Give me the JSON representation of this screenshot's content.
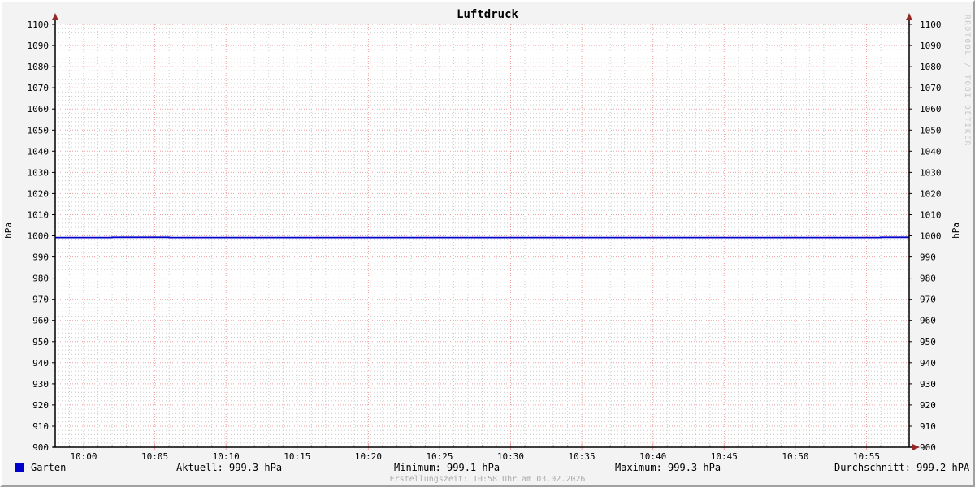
{
  "watermark": "RRDTOOL / TOBI OETIKER",
  "footer": {
    "created": "Erstellungszeit: 10:58 Uhr am 03.02.2026"
  },
  "legend": {
    "series_label": "Garten",
    "stats": {
      "aktuell": "Aktuell: 999.3 hPa",
      "minimum": "Minimum: 999.1 hPa",
      "maximum": "Maximum: 999.3 hPa",
      "durchschnitt": "Durchschnitt: 999.2 hPA"
    }
  },
  "colors": {
    "background": "#f3f3f3",
    "canvas": "#ffffff",
    "grid_minor": "#cccccc",
    "grid_major": "#f0a0a0",
    "axis": "#000000",
    "arrow": "#942626",
    "line": "#0000cc",
    "legend_swatch": "#0000cc",
    "watermark": "#c4c4c4",
    "footer_text": "#ababab"
  },
  "chart_data": {
    "type": "line",
    "title": "Luftdruck",
    "ylabel": "hPa",
    "ylabel_right": "hPa",
    "ylim": [
      900,
      1100
    ],
    "y_major_step": 10,
    "y_minor_step": 2,
    "y_tick_labels": [
      "1100",
      "1090",
      "1080",
      "1070",
      "1060",
      "1050",
      "1040",
      "1030",
      "1020",
      "1010",
      "1000",
      "990",
      "980",
      "970",
      "960",
      "950",
      "940",
      "930",
      "920",
      "910",
      "900"
    ],
    "x_start": "09:58",
    "x_end": "10:58",
    "x_major_step_min": 5,
    "x_minor_step_min": 1,
    "x_tick_labels": [
      "10:00",
      "10:05",
      "10:10",
      "10:15",
      "10:20",
      "10:25",
      "10:30",
      "10:35",
      "10:40",
      "10:45",
      "10:50",
      "10:55"
    ],
    "grid": true,
    "legend_position": "bottom",
    "series": [
      {
        "name": "Garten",
        "color": "#0000cc",
        "style": "step",
        "points": [
          {
            "t": "09:58",
            "v": 999.2
          },
          {
            "t": "10:02",
            "v": 999.3
          },
          {
            "t": "10:06",
            "v": 999.2
          },
          {
            "t": "10:56",
            "v": 999.3
          },
          {
            "t": "10:58",
            "v": 999.3
          }
        ]
      }
    ],
    "stats": {
      "aktuell_hpa": 999.3,
      "minimum_hpa": 999.1,
      "maximum_hpa": 999.3,
      "durchschnitt_hpa": 999.2
    }
  }
}
